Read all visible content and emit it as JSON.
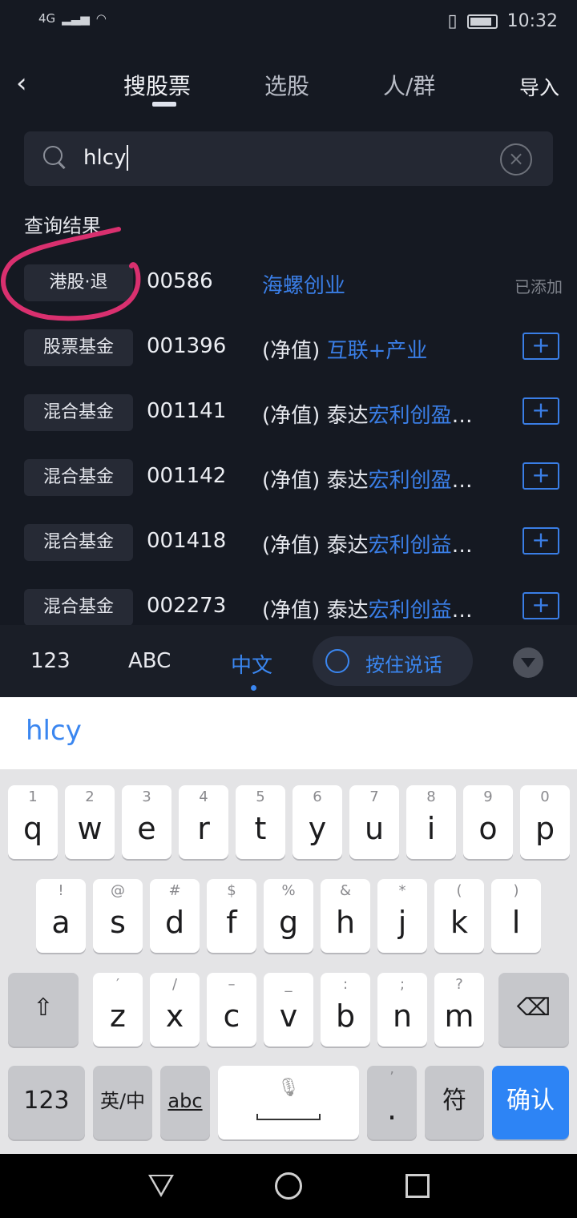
{
  "status_bar": {
    "network": "4G",
    "time": "10:32"
  },
  "nav": {
    "back_icon": "chevron-left-icon",
    "tabs": [
      {
        "label": "搜股票",
        "active": true
      },
      {
        "label": "选股"
      },
      {
        "label": "人/群"
      }
    ],
    "import_label": "导入"
  },
  "search": {
    "value": "hlcy",
    "clear_icon": "clear-circle-icon"
  },
  "results": {
    "label": "查询结果",
    "rows": [
      {
        "type": "港股·退",
        "code": "00586",
        "prefix": "",
        "plain": "",
        "highlight": "海螺创业",
        "suffix": "",
        "status": "已添加"
      },
      {
        "type": "股票基金",
        "code": "001396",
        "prefix": "(净值) ",
        "plain": "",
        "highlight": "互联+产业",
        "suffix": "",
        "status": "+"
      },
      {
        "type": "混合基金",
        "code": "001141",
        "prefix": "(净值) ",
        "plain": "泰达",
        "highlight": "宏利创盈",
        "suffix": "…",
        "status": "+"
      },
      {
        "type": "混合基金",
        "code": "001142",
        "prefix": "(净值) ",
        "plain": "泰达",
        "highlight": "宏利创盈",
        "suffix": "…",
        "status": "+"
      },
      {
        "type": "混合基金",
        "code": "001418",
        "prefix": "(净值) ",
        "plain": "泰达",
        "highlight": "宏利创益",
        "suffix": "…",
        "status": "+"
      },
      {
        "type": "混合基金",
        "code": "002273",
        "prefix": "(净值) ",
        "plain": "泰达",
        "highlight": "宏利创益",
        "suffix": "…",
        "status": "+"
      }
    ]
  },
  "keyboard_bar": {
    "modes": [
      "123",
      "ABC",
      "中文"
    ],
    "active_mode": "中文",
    "voice_label": "按住说话"
  },
  "candidate": "hlcy",
  "keyboard": {
    "row1": [
      [
        "1",
        "q"
      ],
      [
        "2",
        "w"
      ],
      [
        "3",
        "e"
      ],
      [
        "4",
        "r"
      ],
      [
        "5",
        "t"
      ],
      [
        "6",
        "y"
      ],
      [
        "7",
        "u"
      ],
      [
        "8",
        "i"
      ],
      [
        "9",
        "o"
      ],
      [
        "0",
        "p"
      ]
    ],
    "row2": [
      [
        "!",
        "a"
      ],
      [
        "@",
        "s"
      ],
      [
        "#",
        "d"
      ],
      [
        "$",
        "f"
      ],
      [
        "%",
        "g"
      ],
      [
        "&",
        "h"
      ],
      [
        "*",
        "j"
      ],
      [
        "(",
        "k"
      ],
      [
        ")",
        "l"
      ]
    ],
    "row3": [
      [
        "′",
        "z"
      ],
      [
        "/",
        "x"
      ],
      [
        "–",
        "c"
      ],
      [
        "_",
        "v"
      ],
      [
        ":",
        "b"
      ],
      [
        ";",
        "n"
      ],
      [
        "?",
        "m"
      ]
    ],
    "bottom": {
      "num": "123",
      "lang": "英/中",
      "abc": "abc",
      "punct_top": "’",
      "punct": ".",
      "symbol": "符",
      "confirm": "确认"
    }
  },
  "colors": {
    "accent": "#3a7ee6",
    "background": "#151922",
    "confirm": "#2d84f5",
    "annotation": "#d9306f"
  }
}
